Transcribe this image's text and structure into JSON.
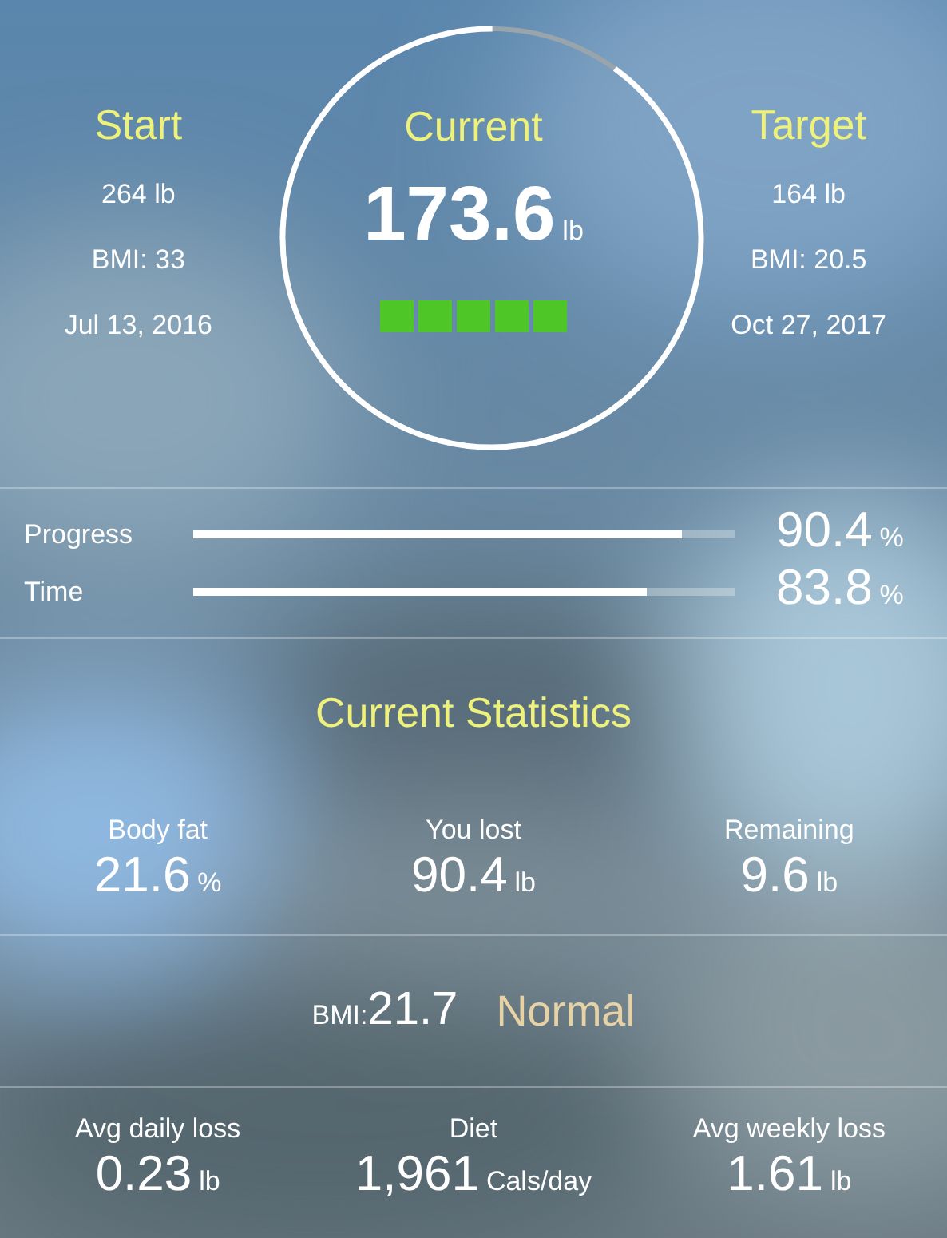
{
  "header": {
    "start": {
      "title": "Start",
      "lines": [
        "264 lb",
        "BMI: 33",
        "Jul 13, 2016"
      ]
    },
    "current": {
      "title": "Current",
      "value": "173.6",
      "unit": "lb"
    },
    "target": {
      "title": "Target",
      "lines": [
        "164 lb",
        "BMI: 20.5",
        "Oct 27, 2017"
      ]
    }
  },
  "bars": [
    {
      "label": "Progress",
      "level": 0.904,
      "value": "90.4",
      "unit": "%"
    },
    {
      "label": "Time",
      "level": 0.838,
      "value": "83.8",
      "unit": "%"
    }
  ],
  "statistics_title": "Current Statistics",
  "stats": [
    {
      "label": "Body fat",
      "value": "21.6",
      "unit": "%"
    },
    {
      "label": "You lost",
      "value": "90.4",
      "unit": "lb"
    },
    {
      "label": "Remaining",
      "value": "9.6",
      "unit": "lb"
    }
  ],
  "bmi": {
    "label": "BMI:",
    "value": "21.7",
    "category": "Normal"
  },
  "averages": [
    {
      "label": "Avg daily loss",
      "value": "0.23",
      "unit": "lb"
    },
    {
      "label": "Diet",
      "value": "1,961",
      "unit": "Cals/day"
    },
    {
      "label": "Avg weekly loss",
      "value": "1.61",
      "unit": "lb"
    }
  ]
}
